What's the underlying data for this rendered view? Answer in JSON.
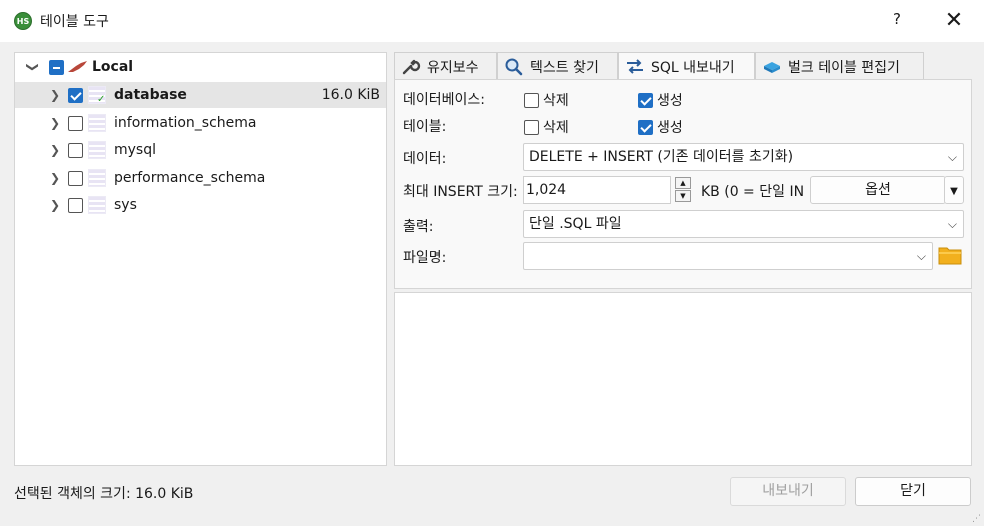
{
  "window": {
    "title": "테이블 도구",
    "help": "?",
    "close": "✕",
    "app_icon_text": "HS"
  },
  "tree": {
    "root": {
      "label": "Local"
    },
    "items": [
      {
        "label": "database",
        "size": "16.0 KiB",
        "checked": true
      },
      {
        "label": "information_schema",
        "size": "",
        "checked": false
      },
      {
        "label": "mysql",
        "size": "",
        "checked": false
      },
      {
        "label": "performance_schema",
        "size": "",
        "checked": false
      },
      {
        "label": "sys",
        "size": "",
        "checked": false
      }
    ]
  },
  "tabs": [
    {
      "label": "유지보수",
      "icon": "wrench-icon"
    },
    {
      "label": "텍스트 찾기",
      "icon": "magnifier-icon"
    },
    {
      "label": "SQL 내보내기",
      "icon": "export-arrows-icon",
      "active": true
    },
    {
      "label": "벌크 테이블 편집기",
      "icon": "table-stack-icon"
    }
  ],
  "export": {
    "databases_label": "데이터베이스:",
    "tables_label": "테이블:",
    "drop_label": "삭제",
    "create_label": "생성",
    "data_label": "데이터:",
    "data_value": "DELETE + INSERT (기존 데이터를 초기화)",
    "max_insert_label": "최대 INSERT 크기:",
    "max_insert_value": "1,024",
    "max_insert_unit": "KB (0 = 단일 IN",
    "options_button": "옵션",
    "output_label": "출력:",
    "output_value": "단일 .SQL 파일",
    "filename_label": "파일명:",
    "filename_value": ""
  },
  "status": {
    "text": "선택된 객체의 크기: 16.0 KiB"
  },
  "buttons": {
    "export": "내보내기",
    "close": "닫기"
  },
  "colors": {
    "accent": "#1f6fc5",
    "folder": "#f2b01e"
  }
}
